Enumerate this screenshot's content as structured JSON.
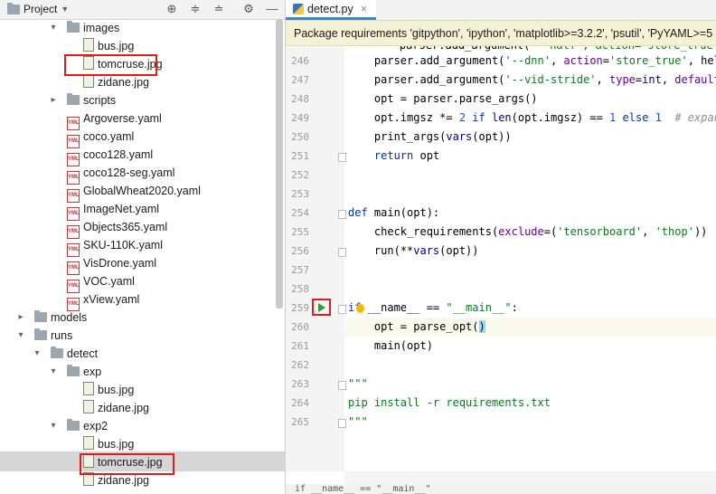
{
  "project_panel": {
    "title": "Project",
    "toolbar_icons": [
      "locate-icon",
      "expand-all-icon",
      "collapse-all-icon",
      "gear-icon",
      "hide-icon"
    ],
    "tree": [
      {
        "label": "images",
        "type": "folder",
        "expanded": true
      },
      {
        "label": "bus.jpg",
        "type": "image"
      },
      {
        "label": "tomcruse.jpg",
        "type": "image"
      },
      {
        "label": "zidane.jpg",
        "type": "image"
      },
      {
        "label": "scripts",
        "type": "folder",
        "expanded": false
      },
      {
        "label": "Argoverse.yaml",
        "type": "yaml"
      },
      {
        "label": "coco.yaml",
        "type": "yaml"
      },
      {
        "label": "coco128.yaml",
        "type": "yaml"
      },
      {
        "label": "coco128-seg.yaml",
        "type": "yaml"
      },
      {
        "label": "GlobalWheat2020.yaml",
        "type": "yaml"
      },
      {
        "label": "ImageNet.yaml",
        "type": "yaml"
      },
      {
        "label": "Objects365.yaml",
        "type": "yaml"
      },
      {
        "label": "SKU-110K.yaml",
        "type": "yaml"
      },
      {
        "label": "VisDrone.yaml",
        "type": "yaml"
      },
      {
        "label": "VOC.yaml",
        "type": "yaml"
      },
      {
        "label": "xView.yaml",
        "type": "yaml"
      },
      {
        "label": "models",
        "type": "folder",
        "expanded": false
      },
      {
        "label": "runs",
        "type": "folder",
        "expanded": true
      },
      {
        "label": "detect",
        "type": "folder",
        "expanded": true
      },
      {
        "label": "exp",
        "type": "folder",
        "expanded": true
      },
      {
        "label": "bus.jpg",
        "type": "image"
      },
      {
        "label": "zidane.jpg",
        "type": "image"
      },
      {
        "label": "exp2",
        "type": "folder",
        "expanded": true
      },
      {
        "label": "bus.jpg",
        "type": "image"
      },
      {
        "label": "tomcruse.jpg",
        "type": "image",
        "selected": true
      },
      {
        "label": "zidane.jpg",
        "type": "image"
      }
    ]
  },
  "editor": {
    "tab_label": "detect.py",
    "notification": "Package requirements 'gitpython', 'ipython', 'matplotlib>=3.2.2', 'psutil', 'PyYAML>=5",
    "line_numbers": [
      "246",
      "247",
      "248",
      "249",
      "250",
      "251",
      "252",
      "253",
      "254",
      "255",
      "256",
      "257",
      "258",
      "259",
      "260",
      "261",
      "262",
      "263",
      "264",
      "265"
    ],
    "partial_top_line": "    parser.add_argument(",
    "status_text": "if __name__ == \"__main__\""
  },
  "colors": {
    "keyword": "#0033b3",
    "string": "#067d17",
    "number": "#1750eb",
    "highlight_box": "#e01b1b",
    "notification_bg": "#f5f1d4"
  }
}
